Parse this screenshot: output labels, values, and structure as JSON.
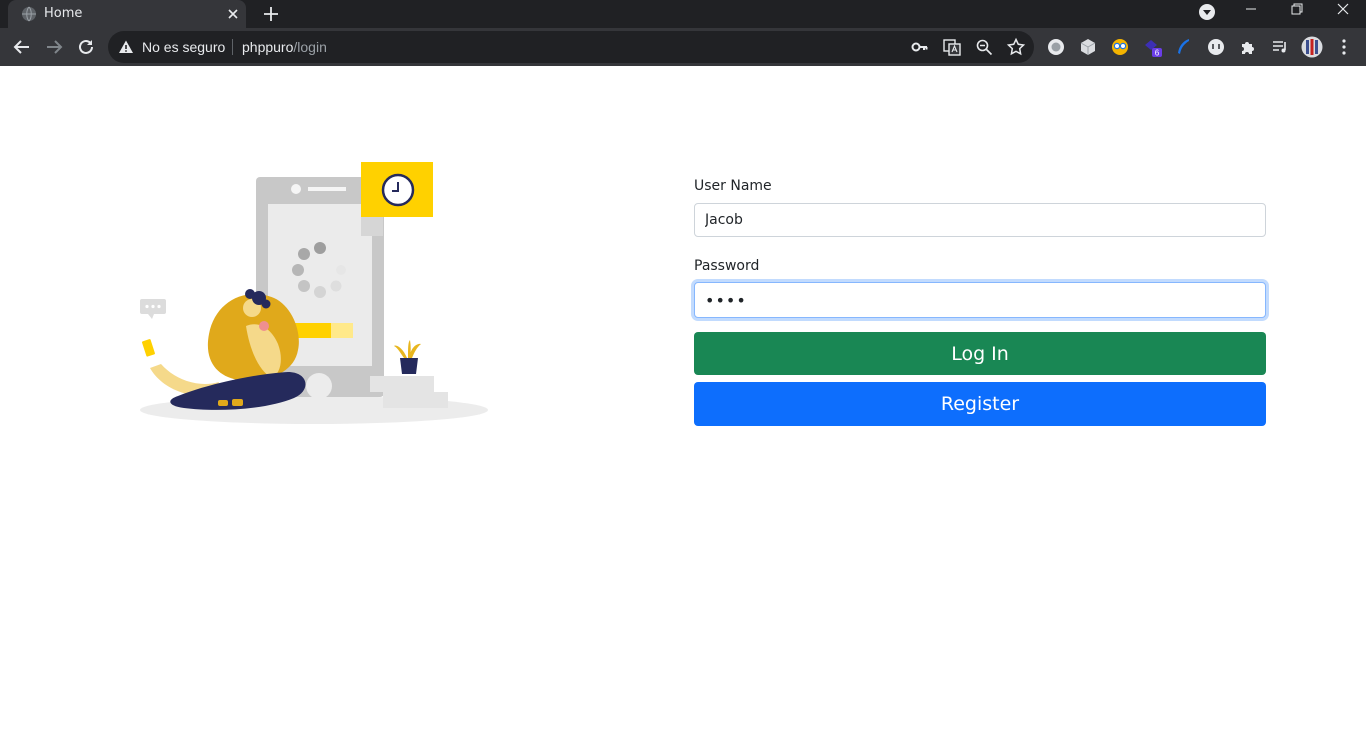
{
  "browser": {
    "tab_title": "Home",
    "security_text": "No es seguro",
    "url_host": "phppuro",
    "url_path": "/login",
    "extension_badge": "6"
  },
  "form": {
    "username_label": "User Name",
    "username_value": "Jacob",
    "password_label": "Password",
    "password_value": "••••",
    "login_label": "Log In",
    "register_label": "Register"
  },
  "colors": {
    "login_button": "#198754",
    "register_button": "#0d6efd",
    "illustration_accent": "#ffd100",
    "illustration_navy": "#252a5c"
  },
  "icons": [
    "globe-icon",
    "close-icon",
    "plus-icon",
    "back-arrow-icon",
    "forward-arrow-icon",
    "reload-icon",
    "warning-icon",
    "key-icon",
    "translate-icon",
    "zoom-icon",
    "star-icon",
    "extensions-puzzle-icon",
    "media-queue-icon",
    "profile-avatar-icon",
    "menu-kebab-icon"
  ]
}
